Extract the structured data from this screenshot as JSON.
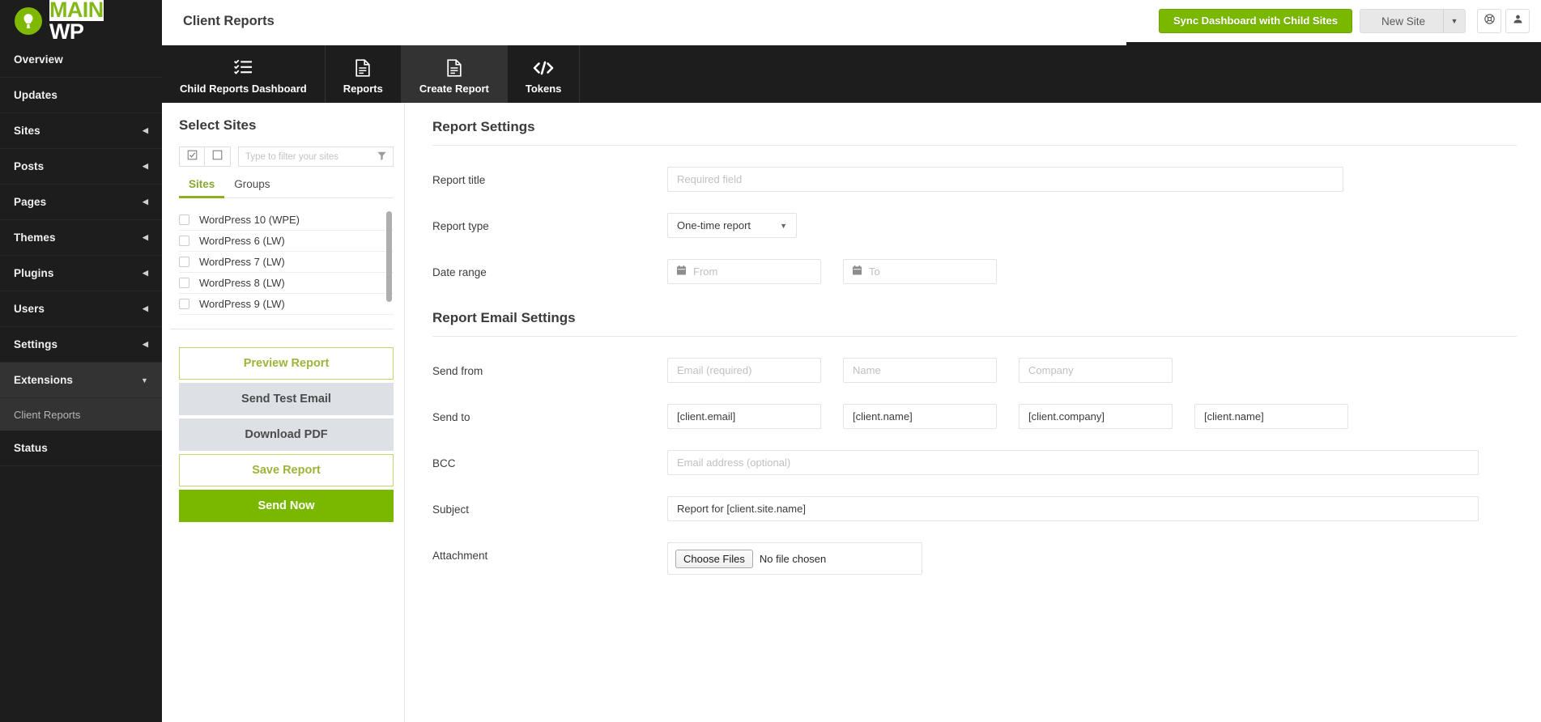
{
  "brand": {
    "name_main": "MAIN",
    "name_wp": "WP",
    "logo_icon": "lightbulb-icon"
  },
  "topbar": {
    "page_title": "Client Reports",
    "sync_button": "Sync Dashboard with Child Sites",
    "new_site_button": "New Site",
    "new_site_caret_icon": "chevron-down-icon",
    "help_icon": "lifebuoy-icon",
    "account_icon": "user-icon",
    "accent_green": "#7ab800"
  },
  "sidebar": {
    "items": [
      {
        "label": "Overview",
        "has_arrow": false,
        "active": false
      },
      {
        "label": "Updates",
        "has_arrow": false,
        "active": false
      },
      {
        "label": "Sites",
        "has_arrow": true,
        "active": false
      },
      {
        "label": "Posts",
        "has_arrow": true,
        "active": false
      },
      {
        "label": "Pages",
        "has_arrow": true,
        "active": false
      },
      {
        "label": "Themes",
        "has_arrow": true,
        "active": false
      },
      {
        "label": "Plugins",
        "has_arrow": true,
        "active": false
      },
      {
        "label": "Users",
        "has_arrow": true,
        "active": false
      },
      {
        "label": "Settings",
        "has_arrow": true,
        "active": false
      },
      {
        "label": "Extensions",
        "has_arrow": true,
        "active": true
      },
      {
        "label": "Status",
        "has_arrow": false,
        "active": false
      }
    ],
    "extensions_sub": [
      {
        "label": "Client Reports",
        "selected": true
      }
    ],
    "arrow_icon": "chevron-left-icon",
    "expanded_arrow_icon": "chevron-down-icon"
  },
  "tabs": [
    {
      "label": "Child Reports Dashboard",
      "icon": "list-check-icon",
      "active": false
    },
    {
      "label": "Reports",
      "icon": "document-icon",
      "active": false
    },
    {
      "label": "Create Report",
      "icon": "document-icon",
      "active": true
    },
    {
      "label": "Tokens",
      "icon": "code-icon",
      "active": false
    }
  ],
  "sites_panel": {
    "title": "Select Sites",
    "select_all_icon": "checkbox-checked-icon",
    "select_none_icon": "checkbox-empty-icon",
    "filter_placeholder": "Type to filter your sites",
    "filter_value": "",
    "filter_icon": "funnel-icon",
    "subtabs": [
      {
        "label": "Sites",
        "active": true
      },
      {
        "label": "Groups",
        "active": false
      }
    ],
    "sites": [
      {
        "label": "WordPress 10 (WPE)",
        "checked": false
      },
      {
        "label": "WordPress 6 (LW)",
        "checked": false
      },
      {
        "label": "WordPress 7 (LW)",
        "checked": false
      },
      {
        "label": "WordPress 8 (LW)",
        "checked": false
      },
      {
        "label": "WordPress 9 (LW)",
        "checked": false
      }
    ],
    "buttons": [
      {
        "label": "Preview Report",
        "style": "outline"
      },
      {
        "label": "Send Test Email",
        "style": "grey"
      },
      {
        "label": "Download PDF",
        "style": "grey"
      },
      {
        "label": "Save Report",
        "style": "outline"
      },
      {
        "label": "Send Now",
        "style": "green"
      }
    ]
  },
  "report_settings": {
    "heading": "Report Settings",
    "report_title": {
      "label": "Report title",
      "placeholder": "Required field",
      "value": ""
    },
    "report_type": {
      "label": "Report type",
      "value": "One-time report",
      "caret_icon": "chevron-down-icon"
    },
    "date_range": {
      "label": "Date range",
      "from_placeholder": "From",
      "to_placeholder": "To",
      "from_value": "",
      "to_value": "",
      "calendar_icon": "calendar-icon"
    }
  },
  "email_settings": {
    "heading": "Report Email Settings",
    "send_from": {
      "label": "Send from",
      "email_placeholder": "Email (required)",
      "name_placeholder": "Name",
      "company_placeholder": "Company",
      "email_value": "",
      "name_value": "",
      "company_value": ""
    },
    "send_to": {
      "label": "Send to",
      "fields": [
        "[client.email]",
        "[client.name]",
        "[client.company]",
        "[client.name]"
      ]
    },
    "bcc": {
      "label": "BCC",
      "placeholder": "Email address (optional)",
      "value": ""
    },
    "subject": {
      "label": "Subject",
      "value": "Report for [client.site.name]"
    },
    "attachment": {
      "label": "Attachment",
      "choose_button": "Choose Files",
      "status": "No file chosen"
    }
  }
}
